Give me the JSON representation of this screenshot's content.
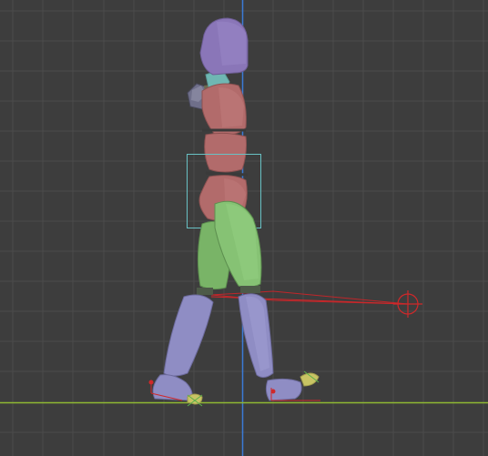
{
  "viewport": {
    "background": "#3d3d3d",
    "grid_color": "#4a4a4a",
    "x_axis_color": "#8fb833",
    "z_axis_color": "#3b7bd6",
    "selection_color": "#68c1c4",
    "ik_target_color": "#d0282a"
  },
  "rig": {
    "head_color": "#8a76b8",
    "neck_color": "#6fb7b3",
    "torso_color": "#b26b6b",
    "thigh_color": "#79b467",
    "shin_color": "#8f8dc4",
    "foot_color": "#c8c464",
    "hand_color": "#6f6f8a",
    "joint_color": "#4d5a48"
  }
}
